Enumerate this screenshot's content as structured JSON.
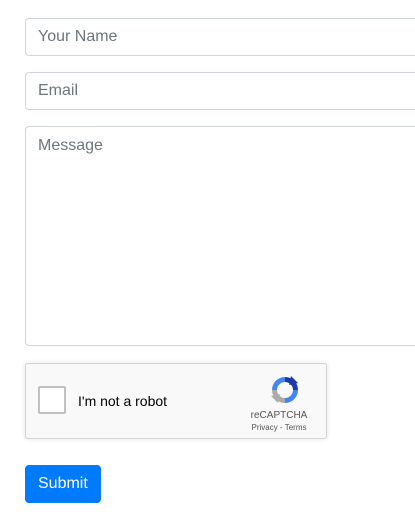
{
  "form": {
    "name_placeholder": "Your Name",
    "email_placeholder": "Email",
    "message_placeholder": "Message",
    "submit_label": "Submit"
  },
  "recaptcha": {
    "checkbox_label": "I'm not a robot",
    "brand": "reCAPTCHA",
    "privacy_label": "Privacy",
    "separator": " - ",
    "terms_label": "Terms",
    "logo_icon": "recaptcha-logo-icon"
  },
  "colors": {
    "primary": "#007bff",
    "input_border": "#ced4da",
    "placeholder": "#6c757d"
  }
}
